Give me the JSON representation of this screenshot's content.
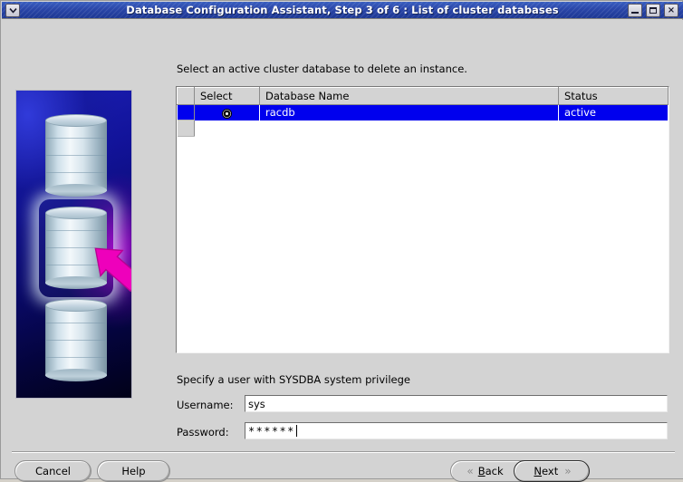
{
  "window": {
    "title": "Database Configuration Assistant, Step 3 of 6 : List of cluster databases",
    "menu_icon": "chevron-down-icon",
    "minimize_label": "",
    "maximize_label": "",
    "close_label": "×"
  },
  "main": {
    "instruction": "Select an active cluster database to delete an instance."
  },
  "table": {
    "columns": [
      "Select",
      "Database Name",
      "Status"
    ],
    "rows": [
      {
        "selected": true,
        "radio": "radio-selected",
        "name": "racdb",
        "status": "active"
      }
    ]
  },
  "credentials": {
    "title": "Specify a user with SYSDBA system privilege",
    "username_label": "Username:",
    "username_value": "sys",
    "username_placeholder": "",
    "password_label": "Password:",
    "password_value": "******",
    "password_placeholder": ""
  },
  "buttons": {
    "cancel": "Cancel",
    "help": "Help",
    "back": "Back",
    "back_mnemonic": "B",
    "next": "Next",
    "next_mnemonic": "N",
    "back_icon": "double-chevron-left-icon",
    "next_icon": "double-chevron-right-icon"
  },
  "artwork": {
    "alt": "three stacked database cylinders with magenta arrow pointing at middle one",
    "accent_color": "#ee00bb",
    "background_color": "#0a0a6e"
  },
  "colors": {
    "titlebar": "#2a46a8",
    "selection": "#0000ee",
    "face": "#d3d3d3"
  }
}
